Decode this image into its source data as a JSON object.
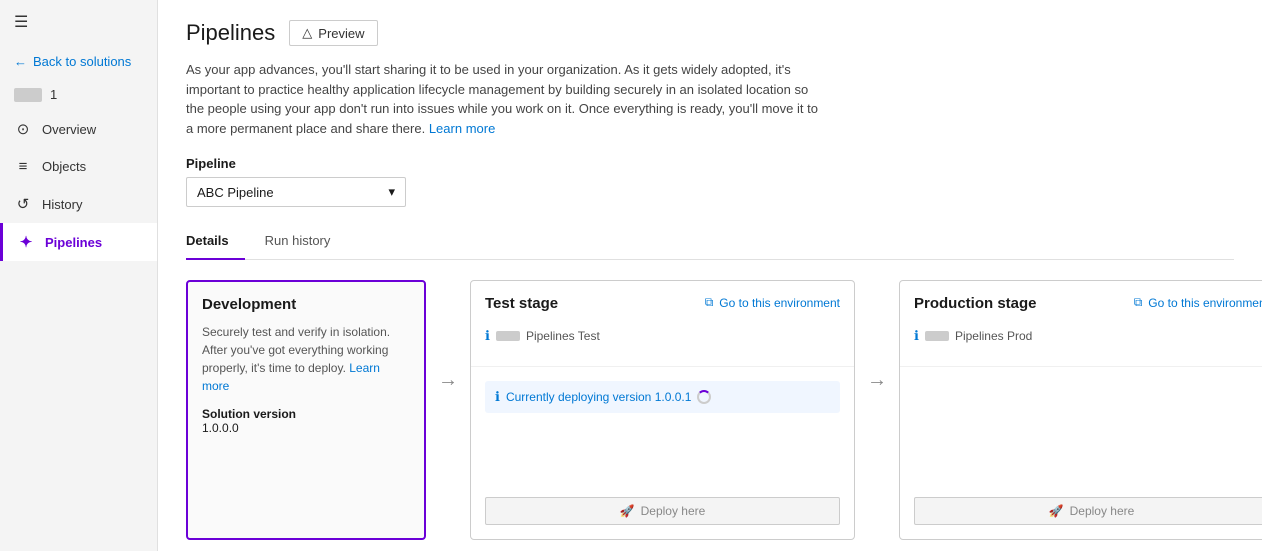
{
  "sidebar": {
    "hamburger": "☰",
    "back_label": "Back to solutions",
    "user_number": "1",
    "items": [
      {
        "id": "overview",
        "label": "Overview",
        "icon": "⊙",
        "active": false
      },
      {
        "id": "objects",
        "label": "Objects",
        "icon": "≡",
        "active": false
      },
      {
        "id": "history",
        "label": "History",
        "icon": "↺",
        "active": false
      },
      {
        "id": "pipelines",
        "label": "Pipelines",
        "icon": "✦",
        "active": true
      }
    ]
  },
  "header": {
    "title": "Pipelines",
    "preview_label": "Preview",
    "preview_icon": "△"
  },
  "description": {
    "text": "As your app advances, you'll start sharing it to be used in your organization. As it gets widely adopted, it's important to practice healthy application lifecycle management by building securely in an isolated location so the people using your app don't run into issues while you work on it. Once everything is ready, you'll move it to a more permanent place and share there.",
    "learn_more": "Learn more"
  },
  "pipeline_selector": {
    "label": "Pipeline",
    "selected": "ABC Pipeline",
    "chevron": "▾"
  },
  "tabs": [
    {
      "id": "details",
      "label": "Details",
      "active": true
    },
    {
      "id": "run-history",
      "label": "Run history",
      "active": false
    }
  ],
  "stages": {
    "development": {
      "title": "Development",
      "description": "Securely test and verify in isolation. After you've got everything working properly, it's time to deploy.",
      "learn_more": "Learn more",
      "solution_version_label": "Solution version",
      "solution_version": "1.0.0.0"
    },
    "test": {
      "title": "Test stage",
      "env_name": "Pipelines Test",
      "go_to_env_label": "Go to this environment",
      "deploying_label": "Currently deploying version 1.0.0.1",
      "deploy_label": "Deploy here"
    },
    "production": {
      "title": "Production stage",
      "env_name": "Pipelines Prod",
      "go_to_env_label": "Go to this environment",
      "deploy_label": "Deploy here"
    }
  },
  "arrows": {
    "symbol": "→"
  }
}
